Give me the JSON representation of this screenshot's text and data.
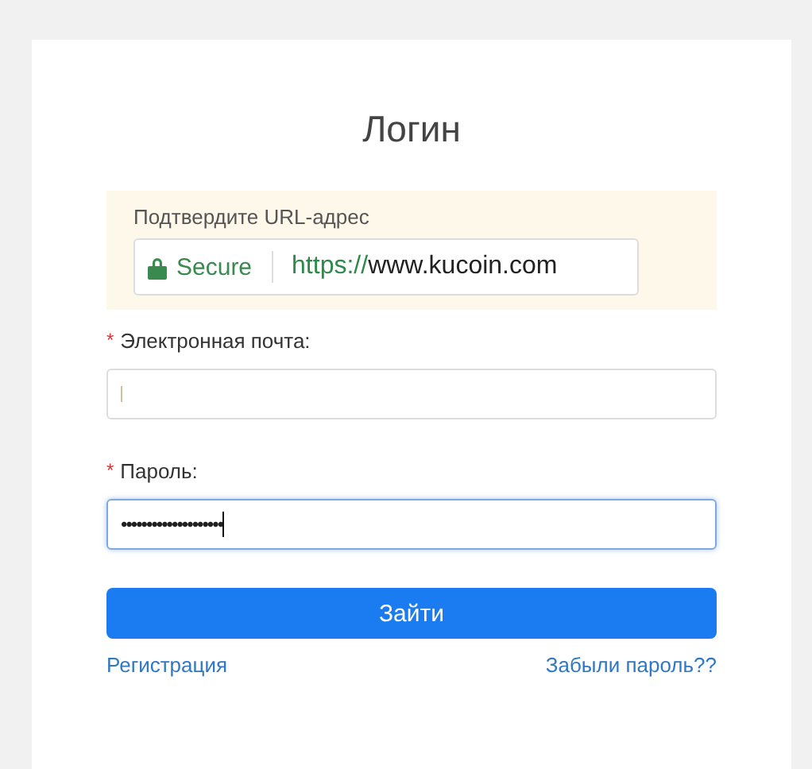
{
  "title": "Логин",
  "url_check": {
    "prompt": "Подтвердите URL-адрес",
    "badge": "Secure",
    "scheme": "https://",
    "host": "www.kucoin.com"
  },
  "fields": [
    {
      "marker": "*",
      "label": "Электронная почта:",
      "focused": false
    },
    {
      "marker": "*",
      "label": "Пароль:",
      "value": "••••••••••••••••••••",
      "focused": true
    }
  ],
  "submit": "Зайти",
  "links": [
    "Регистрация",
    "Забыли пароль??"
  ]
}
